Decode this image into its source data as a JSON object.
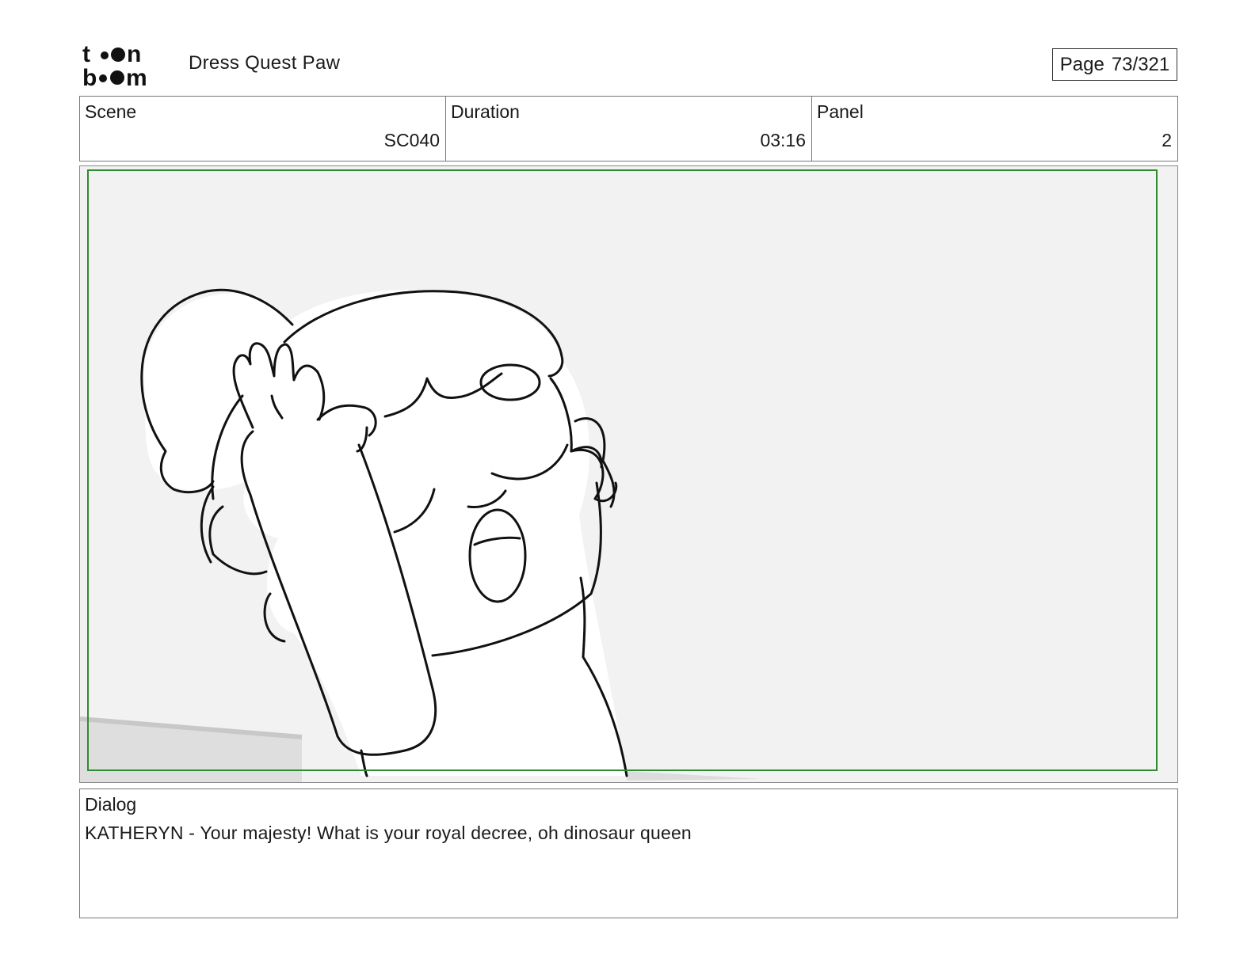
{
  "header": {
    "logo_line1": "toon",
    "logo_line2": "boom",
    "project_title": "Dress Quest Paw",
    "page_label": "Page",
    "page_value": "73/321"
  },
  "info": {
    "scene_label": "Scene",
    "scene_value": "SC040",
    "duration_label": "Duration",
    "duration_value": "03:16",
    "panel_label": "Panel",
    "panel_value": "2"
  },
  "colors": {
    "safe_frame": "#2e8b2e",
    "panel_bg": "#f2f2f2",
    "line_art": "#111111"
  },
  "dialog": {
    "label": "Dialog",
    "text": "KATHERYN - Your majesty! What is your royal decree, oh dinosaur queen"
  }
}
